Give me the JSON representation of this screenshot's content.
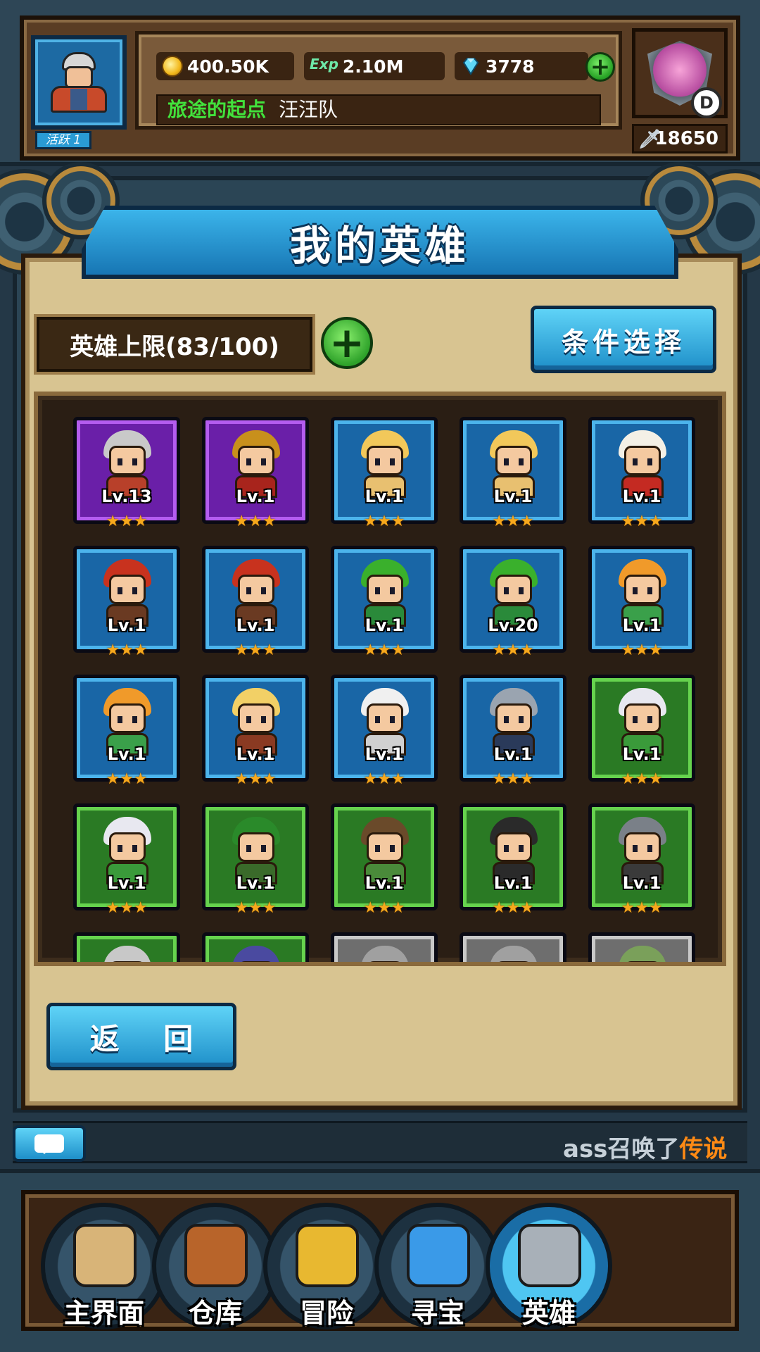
{
  "player": {
    "activity_label": "活跃 1",
    "gold": "400.50K",
    "exp_icon_label": "Exp",
    "exp": "2.10M",
    "gems": "3778",
    "guild_title": "旅途的起点",
    "guild_name": "汪汪队",
    "rank_letter": "D",
    "power": "18650"
  },
  "page": {
    "title": "我的英雄",
    "hero_limit": "英雄上限(83/100)",
    "filter_button": "条件选择",
    "return_button": "返 回"
  },
  "heroes": [
    {
      "level": "Lv.13",
      "stars": "★★★",
      "frame": "purple",
      "hair": "#c9c9c9",
      "body": "#b8402a"
    },
    {
      "level": "Lv.1",
      "stars": "★★★",
      "frame": "purple",
      "hair": "#c8901c",
      "body": "#a8241c"
    },
    {
      "level": "Lv.1",
      "stars": "★★★",
      "frame": "blue",
      "hair": "#f2c85a",
      "body": "#e8c070"
    },
    {
      "level": "Lv.1",
      "stars": "★★★",
      "frame": "blue",
      "hair": "#f2c85a",
      "body": "#e8c070"
    },
    {
      "level": "Lv.1",
      "stars": "★★★",
      "frame": "blue",
      "hair": "#f4f0e6",
      "body": "#c42a22"
    },
    {
      "level": "Lv.1",
      "stars": "★★★",
      "frame": "blue",
      "hair": "#c8321e",
      "body": "#6a3a22"
    },
    {
      "level": "Lv.1",
      "stars": "★★★",
      "frame": "blue",
      "hair": "#c8321e",
      "body": "#6a3a22"
    },
    {
      "level": "Lv.1",
      "stars": "★★★",
      "frame": "blue",
      "hair": "#3ab02c",
      "body": "#2a8a3a"
    },
    {
      "level": "Lv.20",
      "stars": "★★★",
      "frame": "blue",
      "hair": "#3ab02c",
      "body": "#2a8a3a"
    },
    {
      "level": "Lv.1",
      "stars": "★★★",
      "frame": "blue",
      "hair": "#f09a2a",
      "body": "#3aa04a"
    },
    {
      "level": "Lv.1",
      "stars": "★★★",
      "frame": "blue",
      "hair": "#f09a2a",
      "body": "#3aa04a"
    },
    {
      "level": "Lv.1",
      "stars": "★★★",
      "frame": "blue",
      "hair": "#f2d066",
      "body": "#8a3a22"
    },
    {
      "level": "Lv.1",
      "stars": "★★★",
      "frame": "blue",
      "hair": "#f0f0f0",
      "body": "#d0d0d0"
    },
    {
      "level": "Lv.1",
      "stars": "★★★",
      "frame": "blue",
      "hair": "#9aa4b0",
      "body": "#2a3a5a"
    },
    {
      "level": "Lv.1",
      "stars": "★★★",
      "frame": "green",
      "hair": "#e8e8f0",
      "body": "#3a9a3a"
    },
    {
      "level": "Lv.1",
      "stars": "★★★",
      "frame": "green",
      "hair": "#e8e8f0",
      "body": "#3a9a3a"
    },
    {
      "level": "Lv.1",
      "stars": "★★★",
      "frame": "green",
      "hair": "#2a8a2a",
      "body": "#3a6a2a"
    },
    {
      "level": "Lv.1",
      "stars": "★★★",
      "frame": "green",
      "hair": "#6a4a2a",
      "body": "#4a8a3a"
    },
    {
      "level": "Lv.1",
      "stars": "★★★",
      "frame": "green",
      "hair": "#2a2a2a",
      "body": "#2a2a2a"
    },
    {
      "level": "Lv.1",
      "stars": "★★★",
      "frame": "green",
      "hair": "#7a8088",
      "body": "#3a3a3a"
    },
    {
      "level": "",
      "stars": "",
      "frame": "green",
      "hair": "#c8c8c8",
      "body": "#3a6a2a"
    },
    {
      "level": "",
      "stars": "",
      "frame": "green",
      "hair": "#4a4aa0",
      "body": "#3a6a2a"
    },
    {
      "level": "",
      "stars": "",
      "frame": "gray",
      "hair": "#a0a0a0",
      "body": "#7a7a7a"
    },
    {
      "level": "",
      "stars": "",
      "frame": "gray",
      "hair": "#a0a0a0",
      "body": "#7a7a7a"
    },
    {
      "level": "",
      "stars": "",
      "frame": "gray",
      "hair": "#7aa05a",
      "body": "#7a7a7a"
    }
  ],
  "chat": {
    "message_prefix": "ass召唤了",
    "message_highlight": "传说"
  },
  "nav": [
    {
      "label": "主界面",
      "icon": "scroll-icon",
      "color": "#d8b478",
      "active": false
    },
    {
      "label": "仓库",
      "icon": "chest-icon",
      "color": "#b8642a",
      "active": false
    },
    {
      "label": "冒险",
      "icon": "sword-icon",
      "color": "#e8b830",
      "active": false
    },
    {
      "label": "寻宝",
      "icon": "crystal-icon",
      "color": "#3a9ae8",
      "active": false
    },
    {
      "label": "英雄",
      "icon": "helmet-icon",
      "color": "#a8b0b8",
      "active": true
    }
  ]
}
